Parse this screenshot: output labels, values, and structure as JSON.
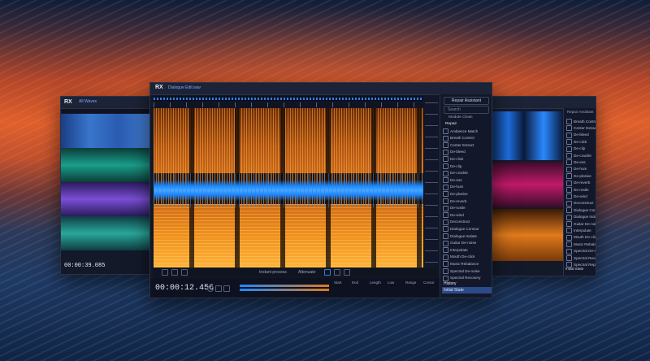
{
  "windows": {
    "left": {
      "tab_label": "All Waves",
      "timecode": "00:00:39.085",
      "track_colors": [
        "#3a7bd5",
        "#1a9e8a",
        "#7a4fd6",
        "#2aa89a"
      ]
    },
    "center": {
      "app_logo": "RX",
      "tab_label": "Dialogue Edit.wav",
      "timecode": "00:00:12.456",
      "history_title": "History",
      "history_item": "Initial State",
      "toolbar_labels": [
        "Instant process",
        "Attenuate"
      ],
      "info_labels": [
        "Start",
        "End",
        "Length",
        "Low",
        "Range",
        "Cursor"
      ],
      "repair_assistant": "Repair Assistant",
      "search_placeholder": "Search",
      "module_chain": "Module Chain",
      "section_repair": "Repair",
      "modules": [
        "Ambience Match",
        "Breath Control",
        "Center Extract",
        "De-bleed",
        "De-click",
        "De-clip",
        "De-crackle",
        "De-ess",
        "De-hum",
        "De-plosive",
        "De-reverb",
        "De-rustle",
        "De-wind",
        "Deconstruct",
        "Dialogue Contour",
        "Dialogue Isolate",
        "Guitar De-noise",
        "Interpolate",
        "Mouth De-click",
        "Music Rebalance",
        "Spectral De-noise",
        "Spectral Recovery"
      ],
      "colors": {
        "spectro_warm": "#e07a1c",
        "wave_blue": "#1e88ff"
      }
    },
    "right": {
      "repair_assistant": "Repair Assistant",
      "history_item": "Initial State",
      "modules": [
        "Breath Control",
        "Center Extract",
        "De-bleed",
        "De-click",
        "De-clip",
        "De-crackle",
        "De-ess",
        "De-hum",
        "De-plosive",
        "De-reverb",
        "De-rustle",
        "De-wind",
        "Deconstruct",
        "Dialogue Contour",
        "Dialogue Isolate",
        "Guitar De-noise",
        "Interpolate",
        "Mouth De-click",
        "Music Rebalance",
        "Spectral De-noise",
        "Spectral Recovery",
        "Spectral Repair"
      ]
    }
  }
}
